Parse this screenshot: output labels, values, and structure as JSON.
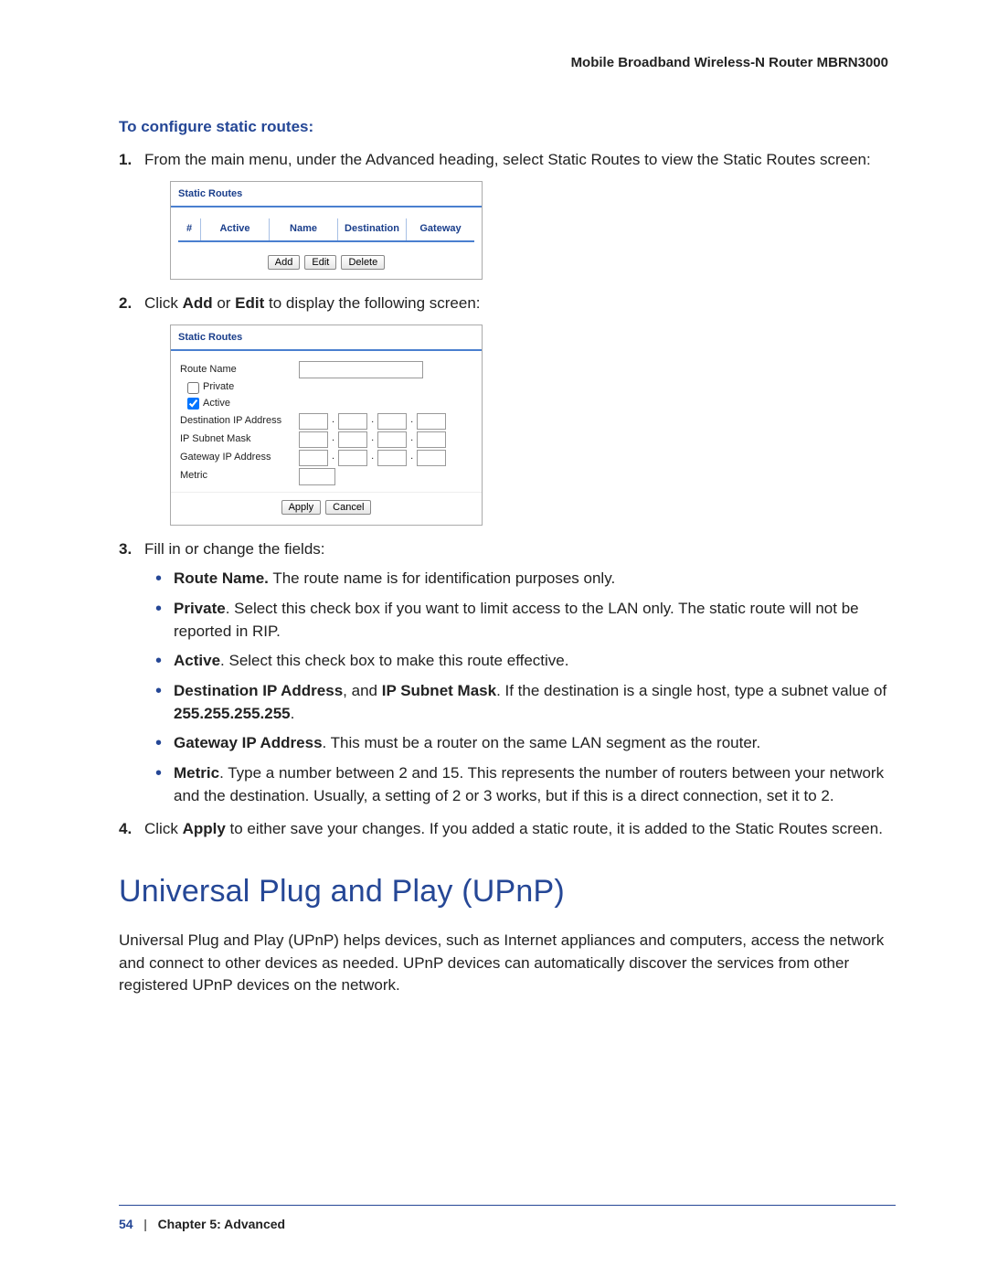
{
  "runningHeader": "Mobile Broadband Wireless-N Router MBRN3000",
  "section": {
    "title": "To configure static routes:",
    "steps": {
      "s1": "From the main menu, under the Advanced heading, select Static Routes to view the Static Routes screen:",
      "s2_a": "Click ",
      "s2_b": "Add",
      "s2_c": " or ",
      "s2_d": "Edit",
      "s2_e": " to display the following screen:",
      "s3": "Fill in or change the fields:",
      "s4_a": "Click ",
      "s4_b": "Apply",
      "s4_c": " to either save your changes. If you added a static route, it is added to the Static Routes screen."
    },
    "fields": {
      "routeName_b": "Route Name.",
      "routeName_t": " The route name is for identification purposes only.",
      "private_b": "Private",
      "private_t": ". Select this check box if you want to limit access to the LAN only. The static route will not be reported in RIP.",
      "active_b": "Active",
      "active_t": ". Select this check box to make this route effective.",
      "dest_b1": "Destination IP Address",
      "dest_m": ", and ",
      "dest_b2": "IP Subnet Mask",
      "dest_t1": ". If the destination is a single host, type a subnet value of ",
      "dest_b3": "255.255.255.255",
      "dest_t2": ".",
      "gw_b": "Gateway IP Address",
      "gw_t": ". This must be a router on the same LAN segment as the router.",
      "metric_b": "Metric",
      "metric_t": ". Type a number between 2 and 15. This represents the number of routers between your network and the destination. Usually, a setting of 2 or 3 works, but if this is a direct connection, set it to 2."
    }
  },
  "shot1": {
    "title": "Static Routes",
    "cols": {
      "hash": "#",
      "active": "Active",
      "name": "Name",
      "dest": "Destination",
      "gw": "Gateway"
    },
    "btns": {
      "add": "Add",
      "edit": "Edit",
      "del": "Delete"
    }
  },
  "shot2": {
    "title": "Static Routes",
    "labels": {
      "routeName": "Route Name",
      "private": "Private",
      "active": "Active",
      "dest": "Destination IP Address",
      "mask": "IP Subnet Mask",
      "gw": "Gateway IP Address",
      "metric": "Metric"
    },
    "btns": {
      "apply": "Apply",
      "cancel": "Cancel"
    }
  },
  "upnp": {
    "heading": "Universal Plug and Play (UPnP)",
    "para": "Universal Plug and Play (UPnP) helps devices, such as Internet appliances and computers, access the network and connect to other devices as needed. UPnP devices can automatically discover the services from other registered UPnP devices on the network."
  },
  "footer": {
    "pageNum": "54",
    "sep": "|",
    "chapter": "Chapter 5:  Advanced"
  }
}
